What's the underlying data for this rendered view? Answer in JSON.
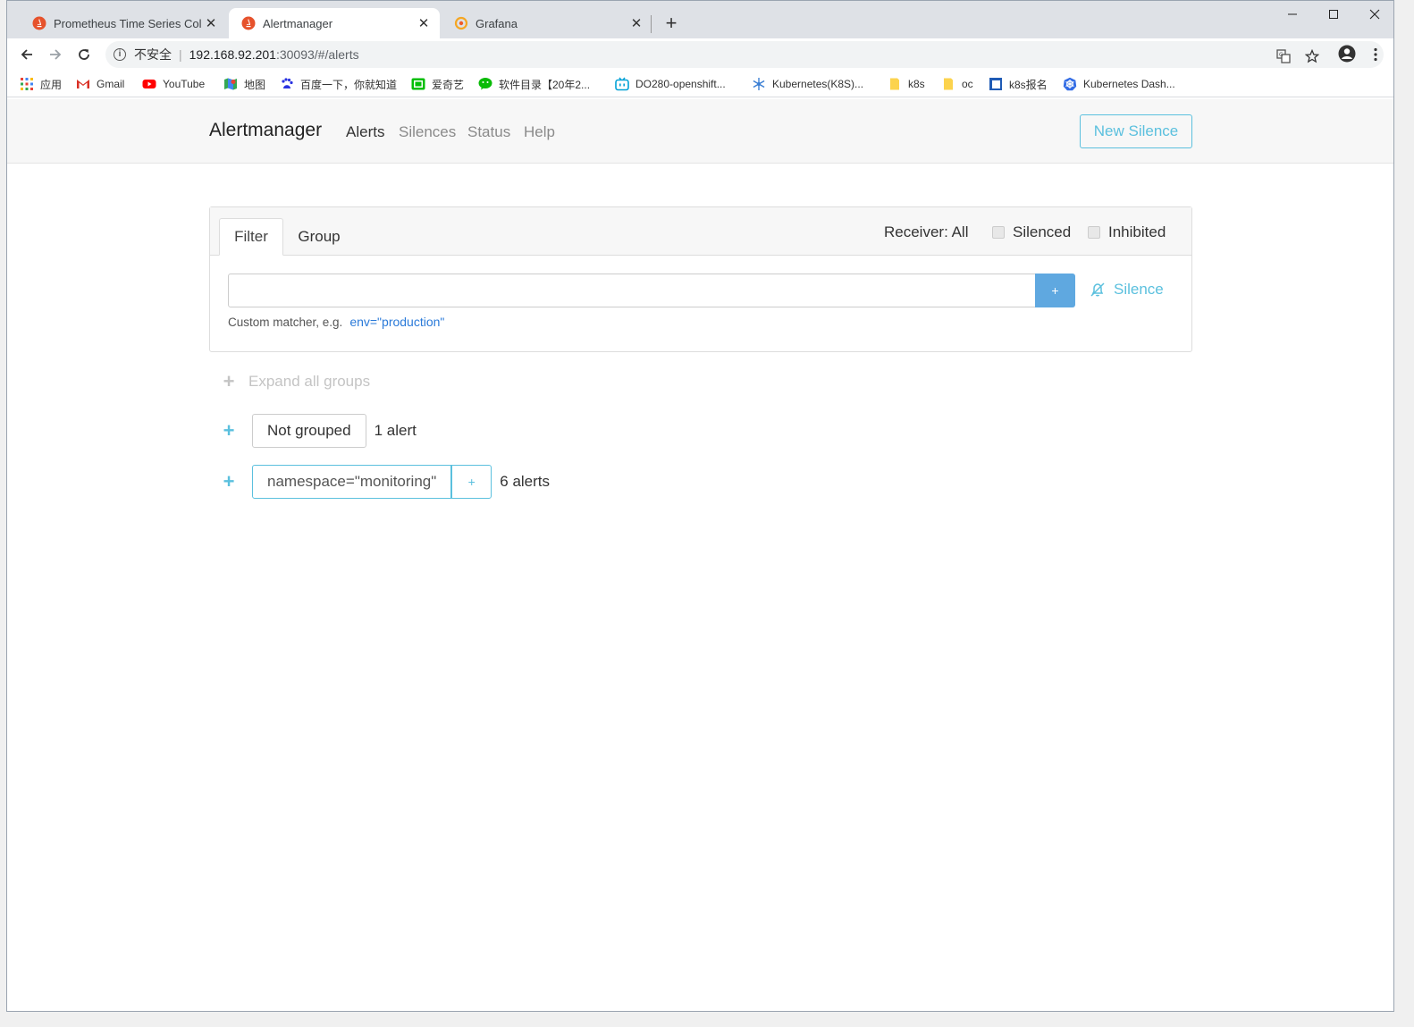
{
  "browser": {
    "tabs": [
      {
        "title": "Prometheus Time Series Colle",
        "icon": "prometheus-icon",
        "active": false
      },
      {
        "title": "Alertmanager",
        "icon": "prometheus-icon",
        "active": true
      },
      {
        "title": "Grafana",
        "icon": "grafana-icon",
        "active": false
      }
    ],
    "new_tab_label": "+",
    "omnibox": {
      "security_label": "不安全",
      "host": "192.168.92.201",
      "path": ":30093/#/alerts"
    },
    "bookmarks": [
      {
        "label": "应用",
        "icon": "apps-grid-icon"
      },
      {
        "label": "Gmail",
        "icon": "gmail-icon"
      },
      {
        "label": "YouTube",
        "icon": "youtube-icon"
      },
      {
        "label": "地图",
        "icon": "maps-icon"
      },
      {
        "label": "百度一下，你就知道",
        "icon": "baidu-icon"
      },
      {
        "label": "爱奇艺",
        "icon": "iqiyi-icon"
      },
      {
        "label": "软件目录【20年2...",
        "icon": "wechat-icon"
      },
      {
        "label": "DO280-openshift...",
        "icon": "bilibili-icon"
      },
      {
        "label": "Kubernetes(K8S)...",
        "icon": "k8s-snowflake-icon"
      },
      {
        "label": "k8s",
        "icon": "folder-icon"
      },
      {
        "label": "oc",
        "icon": "folder-icon"
      },
      {
        "label": "k8s报名",
        "icon": "bookmark-square-icon"
      },
      {
        "label": "Kubernetes Dash...",
        "icon": "kubernetes-helm-icon"
      }
    ]
  },
  "navbar": {
    "brand": "Alertmanager",
    "links": [
      "Alerts",
      "Silences",
      "Status",
      "Help"
    ],
    "active_link": "Alerts",
    "new_silence_label": "New Silence"
  },
  "filter_card": {
    "tabs": [
      "Filter",
      "Group"
    ],
    "active_tab": "Filter",
    "receiver_label": "Receiver: All",
    "silenced_label": "Silenced",
    "inhibited_label": "Inhibited",
    "input_value": "",
    "add_button_label": "+",
    "silence_link_label": "Silence",
    "hint_text": "Custom matcher, e.g.",
    "hint_example": "env=\"production\""
  },
  "alert_groups": {
    "expand_all_label": "Expand all groups",
    "groups": [
      {
        "label": "Not grouped",
        "count_text": "1 alert",
        "has_add": false
      },
      {
        "label": "namespace=\"monitoring\"",
        "count_text": "6 alerts",
        "has_add": true,
        "add_label": "+"
      }
    ]
  },
  "colors": {
    "accent_info": "#5bc0de",
    "primary_button": "#5fa8e0",
    "link_blue": "#2a7ad9"
  }
}
